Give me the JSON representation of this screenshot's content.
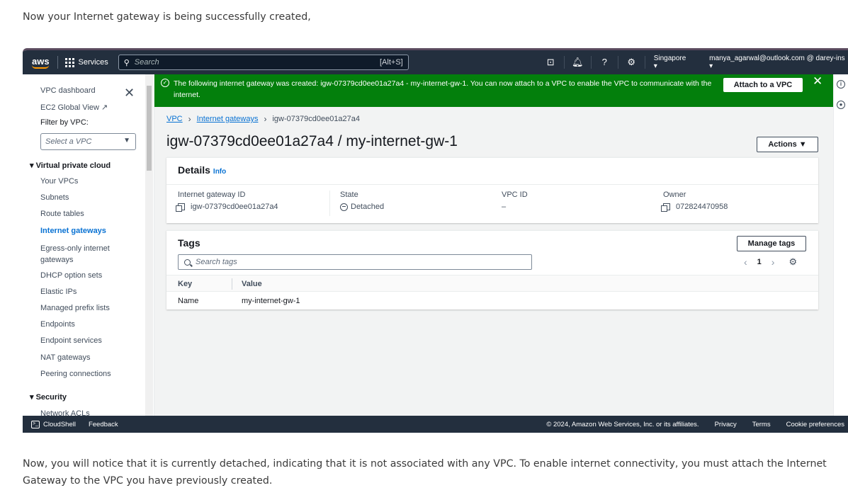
{
  "doc": {
    "intro": "Now your Internet gateway is being successfully created,",
    "outro": "Now, you will notice that it is currently detached, indicating that it is not associated with any VPC. To enable internet connectivity, you must attach the Internet Gateway to the VPC you have previously created."
  },
  "topnav": {
    "logo": "aws",
    "services": "Services",
    "search_placeholder": "Search",
    "search_shortcut": "[Alt+S]",
    "region": "Singapore ▾",
    "account": "manya_agarwal@outlook.com @ darey-ins ▾"
  },
  "sidebar": {
    "dashboard": "VPC dashboard",
    "ec2_global": "EC2 Global View",
    "filter_label": "Filter by VPC:",
    "filter_placeholder": "Select a VPC",
    "section_vpc": "Virtual private cloud",
    "items": [
      "Your VPCs",
      "Subnets",
      "Route tables",
      "Internet gateways",
      "Egress-only internet gateways",
      "DHCP option sets",
      "Elastic IPs",
      "Managed prefix lists",
      "Endpoints",
      "Endpoint services",
      "NAT gateways",
      "Peering connections"
    ],
    "section_security": "Security",
    "partial_item": "Network ACLs"
  },
  "flash": {
    "message": "The following internet gateway was created: igw-07379cd0ee01a27a4 - my-internet-gw-1. You can now attach to a VPC to enable the VPC to communicate with the internet.",
    "attach_label": "Attach to a VPC",
    "type_color": "#037f0c"
  },
  "breadcrumb": {
    "vpc": "VPC",
    "igw": "Internet gateways",
    "current": "igw-07379cd0ee01a27a4"
  },
  "page": {
    "title": "igw-07379cd0ee01a27a4 / my-internet-gw-1",
    "actions_label": "Actions ▼"
  },
  "details": {
    "title": "Details",
    "info": "Info",
    "fields": {
      "igw_id_label": "Internet gateway ID",
      "igw_id_value": "igw-07379cd0ee01a27a4",
      "state_label": "State",
      "state_value": "Detached",
      "vpc_id_label": "VPC ID",
      "vpc_id_value": "–",
      "owner_label": "Owner",
      "owner_value": "072824470958"
    }
  },
  "tags": {
    "title": "Tags",
    "manage_label": "Manage tags",
    "search_placeholder": "Search tags",
    "page_number": "1",
    "columns": [
      "Key",
      "Value"
    ],
    "rows": [
      {
        "key": "Name",
        "value": "my-internet-gw-1"
      }
    ]
  },
  "footer": {
    "cloudshell": "CloudShell",
    "feedback": "Feedback",
    "copyright": "© 2024, Amazon Web Services, Inc. or its affiliates.",
    "privacy": "Privacy",
    "terms": "Terms",
    "cookies": "Cookie preferences"
  }
}
